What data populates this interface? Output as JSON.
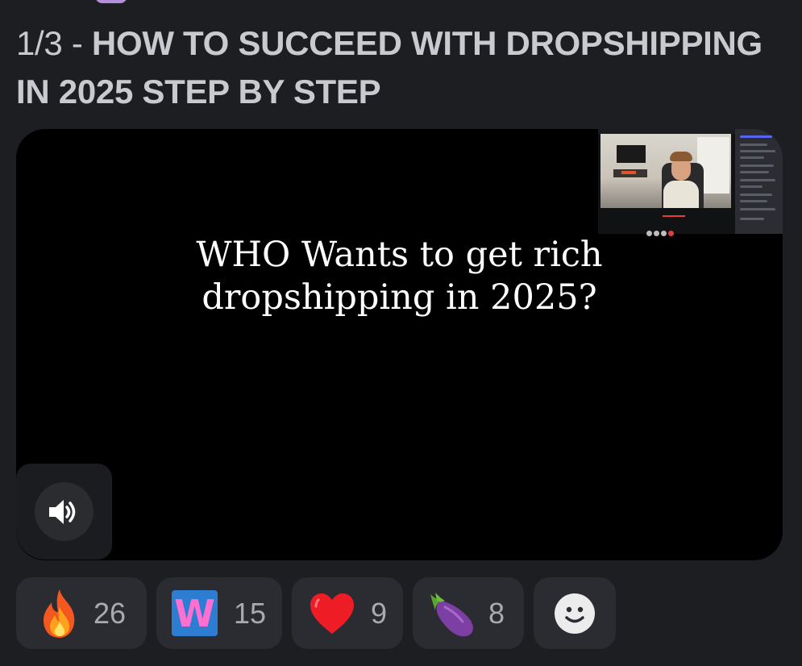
{
  "post": {
    "title_prefix": "1/3 - ",
    "title": "HOW TO SUCCEED WITH DROPSHIPPING IN 2025 STEP BY STEP"
  },
  "video": {
    "caption_line1": "WHO Wants to get rich",
    "caption_line2": "dropshipping in 2025?"
  },
  "reactions": [
    {
      "emoji": "fire-emoji",
      "count": "26"
    },
    {
      "emoji": "letter-w-emoji",
      "letter": "W",
      "count": "15"
    },
    {
      "emoji": "red-heart-emoji",
      "count": "9"
    },
    {
      "emoji": "eggplant-emoji",
      "count": "8"
    },
    {
      "emoji": "add-reaction-icon"
    }
  ],
  "colors": {
    "background": "#1d1e22",
    "pill": "#2b2c31",
    "title": "#c9cad0",
    "count": "#a9aab0",
    "w_badge_bg": "#2d7dd2",
    "w_badge_letter": "#ff6fd0"
  }
}
